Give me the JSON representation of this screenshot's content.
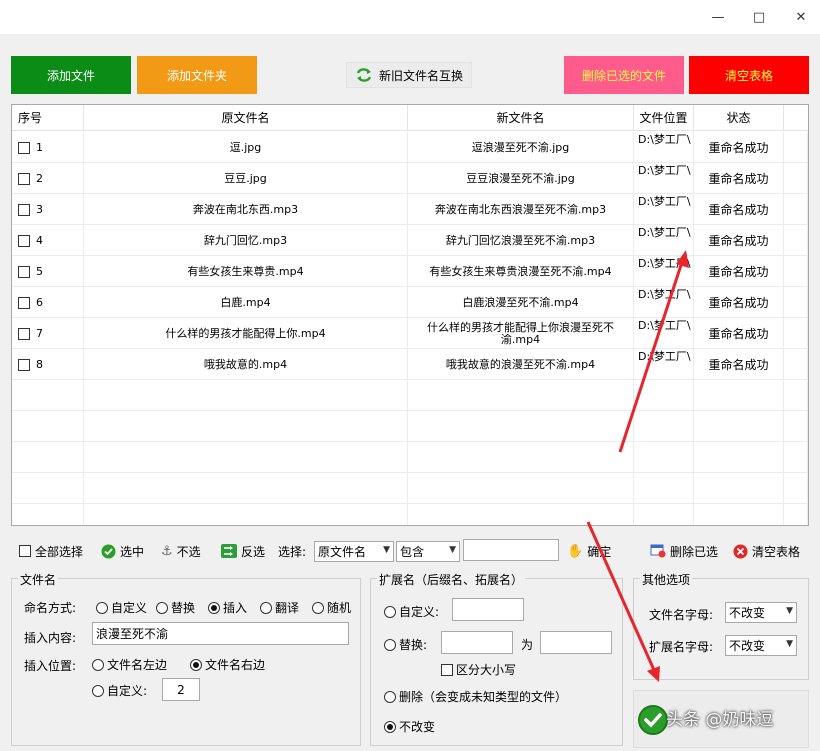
{
  "window": {
    "min_glyph": "—",
    "max_glyph": "□",
    "close_glyph": "✕"
  },
  "toolbar": {
    "add_file": "添加文件",
    "add_folder": "添加文件夹",
    "swap_names": "新旧文件名互换",
    "delete_selected": "删除已选的文件",
    "clear_table": "清空表格"
  },
  "table": {
    "headers": [
      "序号",
      "原文件名",
      "新文件名",
      "文件位置",
      "状态"
    ],
    "rows": [
      {
        "no": "1",
        "old": "逗.jpg",
        "new": "逗浪漫至死不渝.jpg",
        "loc": "D:\\梦工厂\\",
        "status": "重命名成功"
      },
      {
        "no": "2",
        "old": "豆豆.jpg",
        "new": "豆豆浪漫至死不渝.jpg",
        "loc": "D:\\梦工厂\\",
        "status": "重命名成功"
      },
      {
        "no": "3",
        "old": "奔波在南北东西.mp3",
        "new": "奔波在南北东西浪漫至死不渝.mp3",
        "loc": "D:\\梦工厂\\",
        "status": "重命名成功"
      },
      {
        "no": "4",
        "old": "辞九门回忆.mp3",
        "new": "辞九门回忆浪漫至死不渝.mp3",
        "loc": "D:\\梦工厂\\",
        "status": "重命名成功"
      },
      {
        "no": "5",
        "old": "有些女孩生来尊贵.mp4",
        "new": "有些女孩生来尊贵浪漫至死不渝.mp4",
        "loc": "D:\\梦工厂\\",
        "status": "重命名成功"
      },
      {
        "no": "6",
        "old": "白鹿.mp4",
        "new": "白鹿浪漫至死不渝.mp4",
        "loc": "D:\\梦工厂\\",
        "status": "重命名成功"
      },
      {
        "no": "7",
        "old": "什么样的男孩才能配得上你.mp4",
        "new": "什么样的男孩才能配得上你浪漫至死不渝.mp4",
        "loc": "D:\\梦工厂\\",
        "status": "重命名成功"
      },
      {
        "no": "8",
        "old": "哦我故意的.mp4",
        "new": "哦我故意的浪漫至死不渝.mp4",
        "loc": "D:\\梦工厂\\",
        "status": "重命名成功"
      }
    ]
  },
  "bottom_toolbar": {
    "select_all": "全部选择",
    "select": "选中",
    "deselect": "不选",
    "invert": "反选",
    "choose_label": "选择:",
    "field_value": "原文件名",
    "match_value": "包含",
    "match_text": "",
    "confirm": "确定",
    "delete_selected": "删除已选",
    "clear_table": "清空表格"
  },
  "filename_group": {
    "title": "文件名",
    "mode_label": "命名方式:",
    "modes": [
      "自定义",
      "替换",
      "插入",
      "翻译",
      "随机"
    ],
    "mode_selected": "插入",
    "insert_label": "插入内容:",
    "insert_value": "浪漫至死不渝",
    "position_label": "插入位置:",
    "pos_left": "文件名左边",
    "pos_right": "文件名右边",
    "pos_custom": "自定义:",
    "pos_custom_value": "2"
  },
  "ext_group": {
    "title": "扩展名（后缀名、拓展名）",
    "custom": "自定义:",
    "replace": "替换:",
    "replace_for": "为",
    "case_sensitive": "区分大小写",
    "delete": "删除（会变成未知类型的文件）",
    "keep": "不改变"
  },
  "other_group": {
    "title": "其他选项",
    "filename_case_label": "文件名字母:",
    "filename_case_value": "不改变",
    "ext_case_label": "扩展名字母:",
    "ext_case_value": "不改变"
  },
  "start_button": {
    "icon": "check-icon"
  },
  "watermark": "头条 @奶味逗",
  "colors": {
    "add_file": "#0b8c16",
    "add_folder": "#f29a16",
    "delete_selected": "#ff5b8c",
    "clear_table": "#ff0000",
    "annotation_arrow": "#e8242c"
  }
}
